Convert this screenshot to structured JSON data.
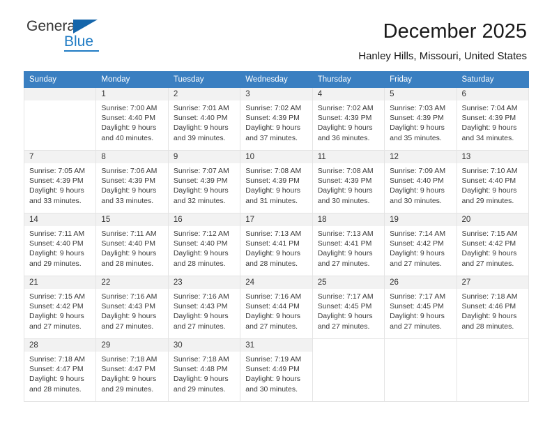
{
  "brand": {
    "name_part1": "General",
    "name_part2": "Blue",
    "flag_icon": "blue-triangle-flag-icon"
  },
  "header": {
    "month_title": "December 2025",
    "location": "Hanley Hills, Missouri, United States"
  },
  "colors": {
    "header_row_bg": "#3a7fc1",
    "daynum_bg": "#f2f2f2",
    "grid_border": "#e4e4e4",
    "brand_blue": "#1f7bc4",
    "text": "#1a1a1a"
  },
  "calendar": {
    "weekday_headers": [
      "Sunday",
      "Monday",
      "Tuesday",
      "Wednesday",
      "Thursday",
      "Friday",
      "Saturday"
    ],
    "weeks": [
      [
        {
          "day": "",
          "empty": true
        },
        {
          "day": "1",
          "sunrise": "Sunrise: 7:00 AM",
          "sunset": "Sunset: 4:40 PM",
          "daylight": "Daylight: 9 hours and 40 minutes."
        },
        {
          "day": "2",
          "sunrise": "Sunrise: 7:01 AM",
          "sunset": "Sunset: 4:40 PM",
          "daylight": "Daylight: 9 hours and 39 minutes."
        },
        {
          "day": "3",
          "sunrise": "Sunrise: 7:02 AM",
          "sunset": "Sunset: 4:39 PM",
          "daylight": "Daylight: 9 hours and 37 minutes."
        },
        {
          "day": "4",
          "sunrise": "Sunrise: 7:02 AM",
          "sunset": "Sunset: 4:39 PM",
          "daylight": "Daylight: 9 hours and 36 minutes."
        },
        {
          "day": "5",
          "sunrise": "Sunrise: 7:03 AM",
          "sunset": "Sunset: 4:39 PM",
          "daylight": "Daylight: 9 hours and 35 minutes."
        },
        {
          "day": "6",
          "sunrise": "Sunrise: 7:04 AM",
          "sunset": "Sunset: 4:39 PM",
          "daylight": "Daylight: 9 hours and 34 minutes."
        }
      ],
      [
        {
          "day": "7",
          "sunrise": "Sunrise: 7:05 AM",
          "sunset": "Sunset: 4:39 PM",
          "daylight": "Daylight: 9 hours and 33 minutes."
        },
        {
          "day": "8",
          "sunrise": "Sunrise: 7:06 AM",
          "sunset": "Sunset: 4:39 PM",
          "daylight": "Daylight: 9 hours and 33 minutes."
        },
        {
          "day": "9",
          "sunrise": "Sunrise: 7:07 AM",
          "sunset": "Sunset: 4:39 PM",
          "daylight": "Daylight: 9 hours and 32 minutes."
        },
        {
          "day": "10",
          "sunrise": "Sunrise: 7:08 AM",
          "sunset": "Sunset: 4:39 PM",
          "daylight": "Daylight: 9 hours and 31 minutes."
        },
        {
          "day": "11",
          "sunrise": "Sunrise: 7:08 AM",
          "sunset": "Sunset: 4:39 PM",
          "daylight": "Daylight: 9 hours and 30 minutes."
        },
        {
          "day": "12",
          "sunrise": "Sunrise: 7:09 AM",
          "sunset": "Sunset: 4:40 PM",
          "daylight": "Daylight: 9 hours and 30 minutes."
        },
        {
          "day": "13",
          "sunrise": "Sunrise: 7:10 AM",
          "sunset": "Sunset: 4:40 PM",
          "daylight": "Daylight: 9 hours and 29 minutes."
        }
      ],
      [
        {
          "day": "14",
          "sunrise": "Sunrise: 7:11 AM",
          "sunset": "Sunset: 4:40 PM",
          "daylight": "Daylight: 9 hours and 29 minutes."
        },
        {
          "day": "15",
          "sunrise": "Sunrise: 7:11 AM",
          "sunset": "Sunset: 4:40 PM",
          "daylight": "Daylight: 9 hours and 28 minutes."
        },
        {
          "day": "16",
          "sunrise": "Sunrise: 7:12 AM",
          "sunset": "Sunset: 4:40 PM",
          "daylight": "Daylight: 9 hours and 28 minutes."
        },
        {
          "day": "17",
          "sunrise": "Sunrise: 7:13 AM",
          "sunset": "Sunset: 4:41 PM",
          "daylight": "Daylight: 9 hours and 28 minutes."
        },
        {
          "day": "18",
          "sunrise": "Sunrise: 7:13 AM",
          "sunset": "Sunset: 4:41 PM",
          "daylight": "Daylight: 9 hours and 27 minutes."
        },
        {
          "day": "19",
          "sunrise": "Sunrise: 7:14 AM",
          "sunset": "Sunset: 4:42 PM",
          "daylight": "Daylight: 9 hours and 27 minutes."
        },
        {
          "day": "20",
          "sunrise": "Sunrise: 7:15 AM",
          "sunset": "Sunset: 4:42 PM",
          "daylight": "Daylight: 9 hours and 27 minutes."
        }
      ],
      [
        {
          "day": "21",
          "sunrise": "Sunrise: 7:15 AM",
          "sunset": "Sunset: 4:42 PM",
          "daylight": "Daylight: 9 hours and 27 minutes."
        },
        {
          "day": "22",
          "sunrise": "Sunrise: 7:16 AM",
          "sunset": "Sunset: 4:43 PM",
          "daylight": "Daylight: 9 hours and 27 minutes."
        },
        {
          "day": "23",
          "sunrise": "Sunrise: 7:16 AM",
          "sunset": "Sunset: 4:43 PM",
          "daylight": "Daylight: 9 hours and 27 minutes."
        },
        {
          "day": "24",
          "sunrise": "Sunrise: 7:16 AM",
          "sunset": "Sunset: 4:44 PM",
          "daylight": "Daylight: 9 hours and 27 minutes."
        },
        {
          "day": "25",
          "sunrise": "Sunrise: 7:17 AM",
          "sunset": "Sunset: 4:45 PM",
          "daylight": "Daylight: 9 hours and 27 minutes."
        },
        {
          "day": "26",
          "sunrise": "Sunrise: 7:17 AM",
          "sunset": "Sunset: 4:45 PM",
          "daylight": "Daylight: 9 hours and 27 minutes."
        },
        {
          "day": "27",
          "sunrise": "Sunrise: 7:18 AM",
          "sunset": "Sunset: 4:46 PM",
          "daylight": "Daylight: 9 hours and 28 minutes."
        }
      ],
      [
        {
          "day": "28",
          "sunrise": "Sunrise: 7:18 AM",
          "sunset": "Sunset: 4:47 PM",
          "daylight": "Daylight: 9 hours and 28 minutes."
        },
        {
          "day": "29",
          "sunrise": "Sunrise: 7:18 AM",
          "sunset": "Sunset: 4:47 PM",
          "daylight": "Daylight: 9 hours and 29 minutes."
        },
        {
          "day": "30",
          "sunrise": "Sunrise: 7:18 AM",
          "sunset": "Sunset: 4:48 PM",
          "daylight": "Daylight: 9 hours and 29 minutes."
        },
        {
          "day": "31",
          "sunrise": "Sunrise: 7:19 AM",
          "sunset": "Sunset: 4:49 PM",
          "daylight": "Daylight: 9 hours and 30 minutes."
        },
        {
          "day": "",
          "empty": true
        },
        {
          "day": "",
          "empty": true
        },
        {
          "day": "",
          "empty": true
        }
      ]
    ]
  }
}
